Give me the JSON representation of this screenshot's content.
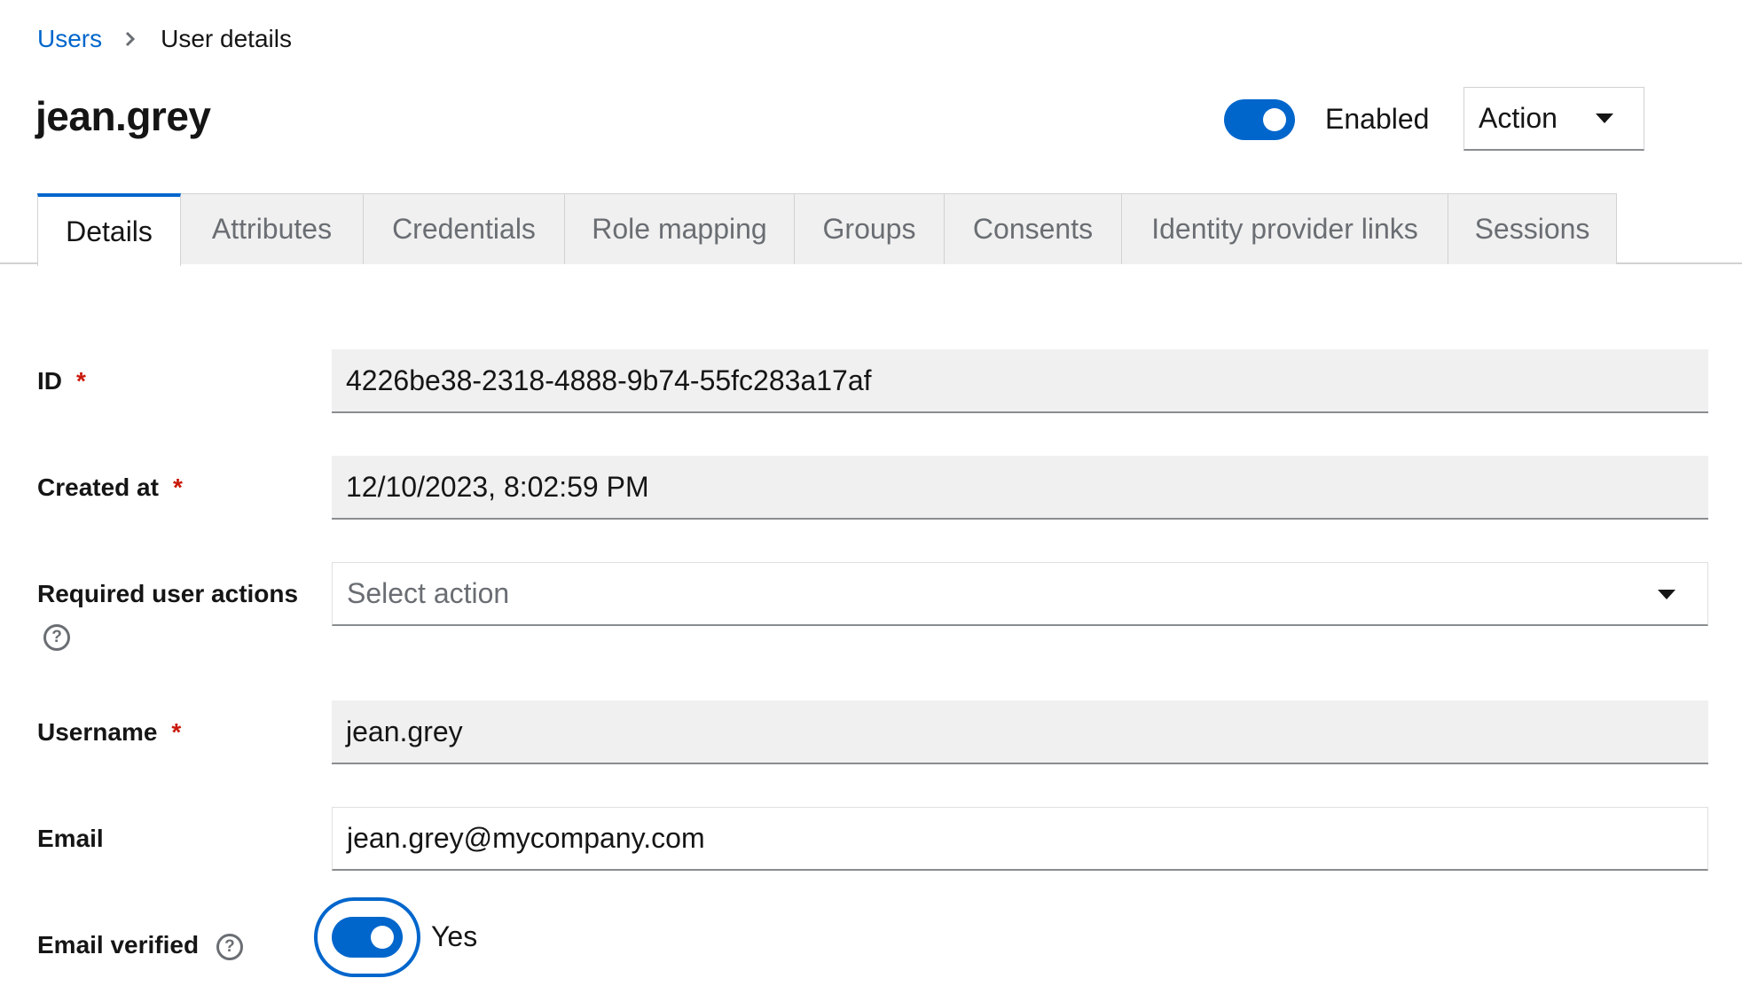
{
  "breadcrumb": {
    "parent": "Users",
    "current": "User details"
  },
  "header": {
    "title": "jean.grey",
    "enabled_label": "Enabled",
    "enabled": true,
    "action_label": "Action"
  },
  "tabs": [
    {
      "label": "Details",
      "active": true
    },
    {
      "label": "Attributes",
      "active": false
    },
    {
      "label": "Credentials",
      "active": false
    },
    {
      "label": "Role mapping",
      "active": false
    },
    {
      "label": "Groups",
      "active": false
    },
    {
      "label": "Consents",
      "active": false
    },
    {
      "label": "Identity provider links",
      "active": false
    },
    {
      "label": "Sessions",
      "active": false
    }
  ],
  "form": {
    "id": {
      "label": "ID",
      "required_mark": "*",
      "value": "4226be38-2318-4888-9b74-55fc283a17af"
    },
    "created_at": {
      "label": "Created at",
      "required_mark": "*",
      "value": "12/10/2023, 8:02:59 PM"
    },
    "required_actions": {
      "label": "Required user actions",
      "placeholder": "Select action"
    },
    "username": {
      "label": "Username",
      "required_mark": "*",
      "value": "jean.grey"
    },
    "email": {
      "label": "Email",
      "value": "jean.grey@mycompany.com"
    },
    "email_verified": {
      "label": "Email verified",
      "value_label": "Yes",
      "checked": true
    }
  },
  "icons": {
    "breadcrumb_separator": "chevron-right-icon",
    "dropdown": "caret-down-icon",
    "help": "question-circle-icon"
  },
  "colors": {
    "accent": "#0066cc",
    "required": "#c9190b",
    "readonly_bg": "#f0f0f0",
    "tab_inactive_bg": "#f0f0f0"
  }
}
